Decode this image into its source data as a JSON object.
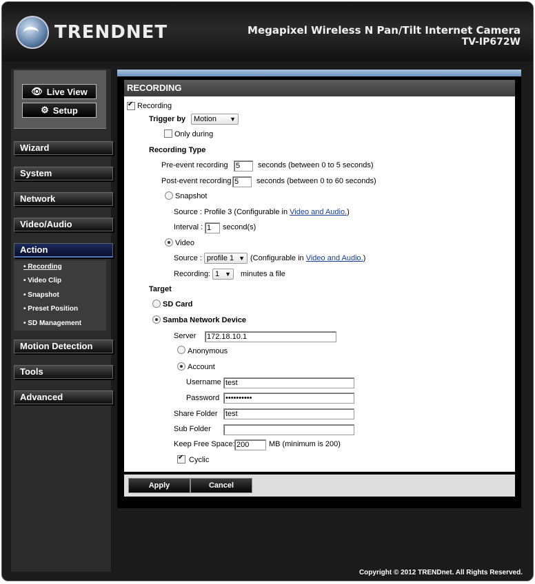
{
  "header": {
    "brand": "TRENDNET",
    "product_name": "Megapixel Wireless N Pan/Tilt Internet Camera",
    "model": "TV-IP672W"
  },
  "left": {
    "live_view": "Live View",
    "setup": "Setup",
    "nav": [
      "Wizard",
      "System",
      "Network",
      "Video/Audio",
      "Action",
      "Motion Detection",
      "Tools",
      "Advanced"
    ],
    "active_nav": "Action",
    "submenu": [
      "Recording",
      "Video Clip",
      "Snapshot",
      "Preset Position",
      "SD Management"
    ],
    "active_sub": "Recording"
  },
  "panel": {
    "title": "RECORDING",
    "recording_label": "Recording",
    "recording_checked": true,
    "trigger_by_label": "Trigger by",
    "trigger_value": "Motion",
    "only_during_label": "Only during",
    "recording_type_label": "Recording Type",
    "pre_event_label": "Pre-event recording",
    "pre_event_value": "5",
    "pre_event_hint": "seconds  (between 0 to 5 seconds)",
    "post_event_label": "Post-event recording",
    "post_event_value": "5",
    "post_event_hint": "seconds  (between 0 to 60 seconds)",
    "snapshot_label": "Snapshot",
    "snapshot_source_text": "Source : Profile 3  (Configurable in",
    "link_video_audio": "Video and Audio.",
    "close_paren": ")",
    "interval_label": "Interval :",
    "interval_value": "1",
    "interval_unit": "second(s)",
    "video_label": "Video",
    "video_source_label": "Source :",
    "video_source_value": "profile 1",
    "configurable_in": "(Configurable in",
    "recording_len_label": "Recording:",
    "recording_len_value": "1",
    "recording_len_unit": "minutes a file",
    "target_label": "Target",
    "sd_card_label": "SD Card",
    "samba_label": "Samba Network Device",
    "server_label": "Server",
    "server_value": "172.18.10.1",
    "anonymous_label": "Anonymous",
    "account_label": "Account",
    "username_label": "Username",
    "username_value": "test",
    "password_label": "Password",
    "password_value": "••••••••••",
    "share_folder_label": "Share Folder",
    "share_folder_value": "test",
    "sub_folder_label": "Sub Folder",
    "sub_folder_value": "",
    "keep_free_label": "Keep Free Space:",
    "keep_free_value": "200",
    "keep_free_hint": "MB (minimum is 200)",
    "cyclic_label": "Cyclic",
    "apply": "Apply",
    "cancel": "Cancel"
  },
  "footer": {
    "copyright": "Copyright © 2012 TRENDnet. All Rights Reserved."
  }
}
